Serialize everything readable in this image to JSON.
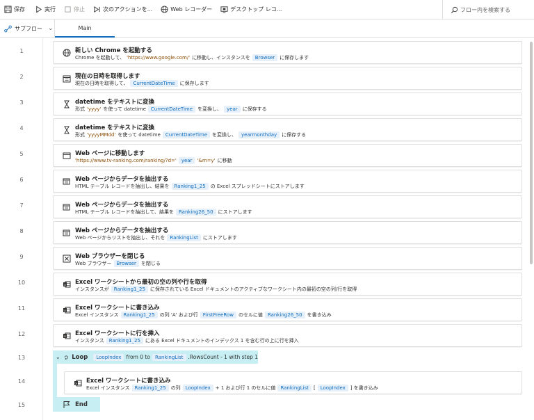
{
  "toolbar": {
    "save": "保存",
    "run": "実行",
    "stop": "停止",
    "next_action": "次のアクションを...",
    "web_recorder": "Web レコーダー",
    "desktop_recorder": "デスクトップ レコ...",
    "search_placeholder": "フロー内を検索する"
  },
  "tabs": {
    "subflow": "サブフロー",
    "main": "Main"
  },
  "colors": {
    "accent": "#0f6cbd",
    "variable_bg": "#e6f0fa",
    "loop_bg": "#c7eef3"
  },
  "lines": [
    "1",
    "2",
    "3",
    "4",
    "5",
    "6",
    "7",
    "8",
    "9",
    "10",
    "11",
    "12",
    "13",
    "14",
    "15"
  ],
  "steps": {
    "s1": {
      "icon": "globe-icon",
      "title": "新しい Chrome を起動する",
      "d1": "Chrome を起動して、",
      "d2": "'https://www.google.com/'",
      "d3": " に移動し、インスタンスを",
      "v1": "Browser",
      "d4": "に保存します"
    },
    "s2": {
      "icon": "calendar-icon",
      "title": "現在の日時を取得します",
      "d1": "現在の日時を取得して、",
      "v1": "CurrentDateTime",
      "d2": "に保存します"
    },
    "s3": {
      "icon": "hourglass-icon",
      "title": "datetime をテキストに変換",
      "d1": "形式",
      "d2": "'yyyy'",
      "d3": "を使って datetime",
      "v1": "CurrentDateTime",
      "d4": "を変換し、",
      "v2": "year",
      "d5": "に保存する"
    },
    "s4": {
      "icon": "hourglass-icon",
      "title": "datetime をテキストに変換",
      "d1": "形式",
      "d2": "'yyyyMMdd'",
      "d3": "を使って datetime",
      "v1": "CurrentDateTime",
      "d4": "を変換し、",
      "v2": "yearmonthday",
      "d5": "に保存する"
    },
    "s5": {
      "icon": "browser-window-icon",
      "title": "Web ページに移動します",
      "d1": "'https://www.tv-ranking.com/ranking/?d='",
      "v1": "year",
      "d2": "'&m=y'",
      "d3": "に移動"
    },
    "s6": {
      "icon": "web-extract-icon",
      "title": "Web ページからデータを抽出する",
      "d1": "HTML テーブル レコードを抽出し、結果を",
      "v1": "Ranking1_25",
      "d2": "の Excel スプレッドシートにストアします"
    },
    "s7": {
      "icon": "web-extract-icon",
      "title": "Web ページからデータを抽出する",
      "d1": "HTML テーブル レコードを抽出して、結果を",
      "v1": "Ranking26_50",
      "d2": "にストアします"
    },
    "s8": {
      "icon": "web-extract-icon",
      "title": "Web ページからデータを抽出する",
      "d1": "Web ページからリストを抽出し、それを",
      "v1": "RankingList",
      "d2": "にストアします"
    },
    "s9": {
      "icon": "close-browser-icon",
      "title": "Web ブラウザーを閉じる",
      "d1": "Web ブラウザー",
      "v1": "Browser",
      "d2": "を閉じる"
    },
    "s10": {
      "icon": "excel-icon",
      "title": "Excel ワークシートから最初の空の列や行を取得",
      "d1": "インスタンスが",
      "v1": "Ranking1_25",
      "d2": "に保存されている Excel ドキュメントのアクティブなワークシート内の最初の空の列/行を取得"
    },
    "s11": {
      "icon": "excel-icon",
      "title": "Excel ワークシートに書き込み",
      "d1": "Excel インスタンス",
      "v1": "Ranking1_25",
      "d2": "の列 'A' および行",
      "v2": "FirstFreeRow",
      "d3": "のセルに値",
      "v3": "Ranking26_50",
      "d4": "を書き込み"
    },
    "s12": {
      "icon": "excel-icon",
      "title": "Excel ワークシートに行を挿入",
      "d1": "インスタンス",
      "v1": "Ranking1_25",
      "d2": "にある Excel ドキュメントのインデックス 1 を含む行の上に行を挿入"
    },
    "s13": {
      "icon": "loop-icon",
      "title": "Loop",
      "v1": "LoopIndex",
      "d1": "from 0 to",
      "v2": "RankingList",
      "d2": ".RowsCount - 1 with step 1"
    },
    "s14": {
      "icon": "excel-icon",
      "title": "Excel ワークシートに書き込み",
      "d1": "Excel インスタンス",
      "v1": "Ranking1_25",
      "d2": "の列",
      "v2": "LoopIndex",
      "d3": "+ 1 および行 1 のセルに値",
      "v3": "RankingList",
      "d4": "[",
      "v4": "LoopIndex",
      "d5": "] を書き込み"
    },
    "s15": {
      "icon": "flag-icon",
      "title": "End"
    }
  }
}
